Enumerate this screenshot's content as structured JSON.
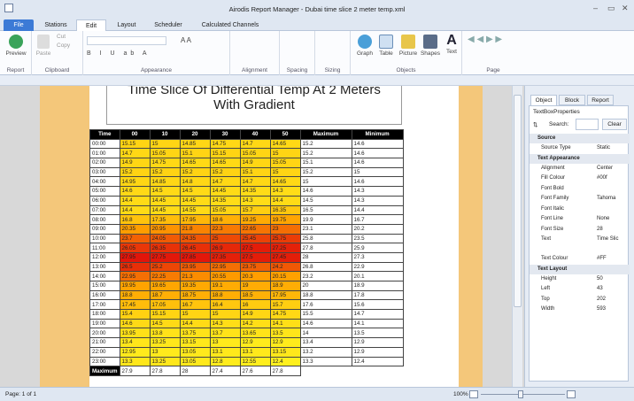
{
  "app": {
    "title": "Airodis Report Manager - Dubai time slice 2 meter temp.xml"
  },
  "tabs": [
    "File",
    "Stations",
    "Edit",
    "Layout",
    "Scheduler",
    "Calculated Channels"
  ],
  "active_tab": "Edit",
  "ribbon": {
    "groups": [
      "Report",
      "Clipboard",
      "Appearance",
      "Alignment",
      "Spacing",
      "Sizing",
      "Objects",
      "Page"
    ],
    "preview_label": "Preview",
    "paste_label": "Paste",
    "cut_label": "Cut",
    "copy_label": "Copy",
    "objects": [
      "Graph",
      "Table",
      "Picture",
      "Shapes",
      "Text"
    ]
  },
  "report": {
    "title_line1": "Time Slice Of Differential Temp At 2 Meters",
    "title_line2": "With Gradient",
    "columns": [
      "Time",
      "00",
      "10",
      "20",
      "30",
      "40",
      "50",
      "Maximum",
      "Minimum"
    ],
    "rows": [
      [
        "00:00",
        "15.15",
        "15",
        "14.85",
        "14.75",
        "14.7",
        "14.65",
        "15.2",
        "14.6"
      ],
      [
        "01:00",
        "14.7",
        "15.05",
        "15.1",
        "15.15",
        "15.05",
        "15",
        "15.2",
        "14.6"
      ],
      [
        "02:00",
        "14.9",
        "14.75",
        "14.65",
        "14.65",
        "14.9",
        "15.05",
        "15.1",
        "14.6"
      ],
      [
        "03:00",
        "15.2",
        "15.2",
        "15.2",
        "15.2",
        "15.1",
        "15",
        "15.2",
        "15"
      ],
      [
        "04:00",
        "14.95",
        "14.85",
        "14.8",
        "14.7",
        "14.7",
        "14.65",
        "15",
        "14.6"
      ],
      [
        "05:00",
        "14.6",
        "14.5",
        "14.5",
        "14.45",
        "14.35",
        "14.3",
        "14.6",
        "14.3"
      ],
      [
        "06:00",
        "14.4",
        "14.45",
        "14.45",
        "14.35",
        "14.3",
        "14.4",
        "14.5",
        "14.3"
      ],
      [
        "07:00",
        "14.4",
        "14.45",
        "14.55",
        "15.05",
        "15.7",
        "16.35",
        "16.5",
        "14.4"
      ],
      [
        "08:00",
        "16.8",
        "17.35",
        "17.95",
        "18.6",
        "19.25",
        "19.75",
        "19.9",
        "16.7"
      ],
      [
        "09:00",
        "20.35",
        "20.95",
        "21.8",
        "22.3",
        "22.65",
        "23",
        "23.1",
        "20.2"
      ],
      [
        "10:00",
        "23.7",
        "24.05",
        "24.35",
        "25",
        "25.45",
        "25.75",
        "25.8",
        "23.5"
      ],
      [
        "11:00",
        "26.05",
        "26.35",
        "26.45",
        "26.9",
        "27.5",
        "27.25",
        "27.8",
        "25.9"
      ],
      [
        "12:00",
        "27.95",
        "27.75",
        "27.85",
        "27.35",
        "27.5",
        "27.45",
        "28",
        "27.3"
      ],
      [
        "13:00",
        "26.5",
        "25.2",
        "23.95",
        "22.95",
        "23.75",
        "24.2",
        "26.8",
        "22.9"
      ],
      [
        "14:00",
        "22.95",
        "22.25",
        "21.3",
        "20.55",
        "20.3",
        "20.15",
        "23.2",
        "20.1"
      ],
      [
        "15:00",
        "19.95",
        "19.65",
        "19.35",
        "19.1",
        "19",
        "18.9",
        "20",
        "18.9"
      ],
      [
        "16:00",
        "18.8",
        "18.7",
        "18.75",
        "18.8",
        "18.5",
        "17.95",
        "18.8",
        "17.8"
      ],
      [
        "17:00",
        "17.45",
        "17.05",
        "16.7",
        "16.4",
        "16",
        "15.7",
        "17.6",
        "15.6"
      ],
      [
        "18:00",
        "15.4",
        "15.15",
        "15",
        "15",
        "14.9",
        "14.75",
        "15.5",
        "14.7"
      ],
      [
        "19:00",
        "14.6",
        "14.5",
        "14.4",
        "14.3",
        "14.2",
        "14.1",
        "14.6",
        "14.1"
      ],
      [
        "20:00",
        "13.95",
        "13.8",
        "13.75",
        "13.7",
        "13.65",
        "13.5",
        "14",
        "13.5"
      ],
      [
        "21:00",
        "13.4",
        "13.25",
        "13.15",
        "13",
        "12.9",
        "12.9",
        "13.4",
        "12.9"
      ],
      [
        "22:00",
        "12.95",
        "13",
        "13.05",
        "13.1",
        "13.1",
        "13.15",
        "13.2",
        "12.9"
      ],
      [
        "23:00",
        "13.3",
        "13.25",
        "13.05",
        "12.8",
        "12.55",
        "12.4",
        "13.3",
        "12.4"
      ]
    ],
    "max_row": [
      "Maximum",
      "27.9",
      "27.8",
      "28",
      "27.4",
      "27.6",
      "27.8"
    ]
  },
  "properties": {
    "tabs": [
      "Object",
      "Block",
      "Report"
    ],
    "header": "TextBoxProperties",
    "search_label": "Search:",
    "clear_label": "Clear",
    "sections": [
      {
        "title": "Source",
        "rows": [
          [
            "Source Type",
            "Static"
          ]
        ]
      },
      {
        "title": "Text Appearance",
        "rows": [
          [
            "Alignment",
            "Center"
          ],
          [
            "Fill Colour",
            "#00f"
          ],
          [
            "Font Bold",
            ""
          ],
          [
            "Font Family",
            "Tahoma"
          ],
          [
            "Font Italic",
            ""
          ],
          [
            "Font Line",
            "None"
          ],
          [
            "Font Size",
            "28"
          ],
          [
            "Text",
            "Time Slic"
          ],
          [
            "Text Colour",
            "#FF"
          ]
        ]
      },
      {
        "title": "Text Layout",
        "rows": [
          [
            "Height",
            "50"
          ],
          [
            "Left",
            "43"
          ],
          [
            "Top",
            "202"
          ],
          [
            "Width",
            "593"
          ]
        ]
      }
    ]
  },
  "status": {
    "page": "Page: 1 of 1",
    "zoom": "100%"
  },
  "colors": {
    "accent": "#3c7ad6",
    "band": "#f4c77a"
  }
}
